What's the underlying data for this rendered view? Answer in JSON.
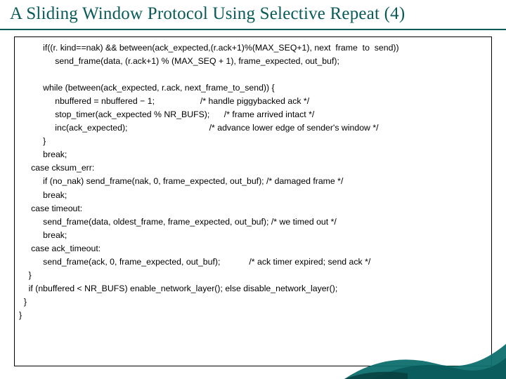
{
  "title": "A Sliding Window Protocol Using Selective Repeat (4)",
  "code": "          if((r. kind==nak) && between(ack_expected,(r.ack+1)%(MAX_SEQ+1), next  frame  to  send))\n               send_frame(data, (r.ack+1) % (MAX_SEQ + 1), frame_expected, out_buf);\n\n          while (between(ack_expected, r.ack, next_frame_to_send)) {\n               nbuffered = nbuffered − 1;                   /* handle piggybacked ack */\n               stop_timer(ack_expected % NR_BUFS);      /* frame arrived intact */\n               inc(ack_expected);                                  /* advance lower edge of sender's window */\n          }\n          break;\n     case cksum_err:\n          if (no_nak) send_frame(nak, 0, frame_expected, out_buf); /* damaged frame */\n          break;\n     case timeout:\n          send_frame(data, oldest_frame, frame_expected, out_buf); /* we timed out */\n          break;\n     case ack_timeout:\n          send_frame(ack, 0, frame_expected, out_buf);            /* ack timer expired; send ack */\n    }\n    if (nbuffered < NR_BUFS) enable_network_layer(); else disable_network_layer();\n  }\n}"
}
